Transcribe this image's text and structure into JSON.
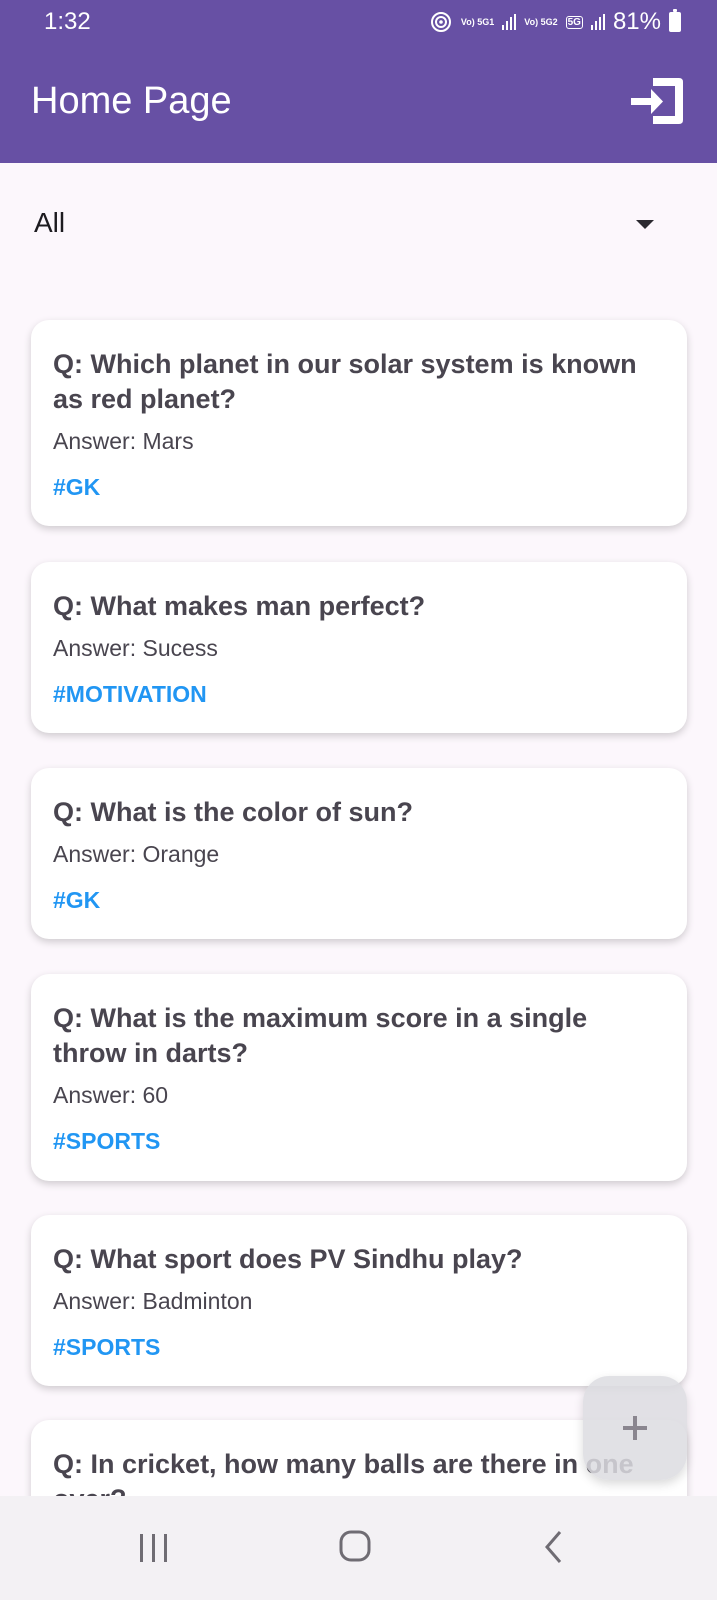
{
  "status_bar": {
    "time": "1:32",
    "battery": "81%",
    "net1": "Vo) 5G1",
    "net2": "Vo) 5G2",
    "badge": "5G"
  },
  "app_bar": {
    "title": "Home Page"
  },
  "filter": {
    "selected": "All"
  },
  "cards": [
    {
      "question": "Q: Which planet in our solar system is known as red planet?",
      "answer": "Answer: Mars",
      "tag": "#GK"
    },
    {
      "question": "Q: What makes man perfect?",
      "answer": "Answer: Sucess",
      "tag": "#MOTIVATION"
    },
    {
      "question": "Q: What is the color of sun?",
      "answer": "Answer: Orange",
      "tag": "#GK"
    },
    {
      "question": "Q: What is the maximum score in a single throw in darts?",
      "answer": "Answer: 60",
      "tag": "#SPORTS"
    },
    {
      "question": "Q: What sport does PV Sindhu play?",
      "answer": "Answer: Badminton",
      "tag": "#SPORTS"
    },
    {
      "question": "Q: In cricket, how many balls are there in one over?"
    }
  ],
  "colors": {
    "primary": "#6750a4",
    "tag": "#2196f3",
    "background": "#fcf7fc"
  }
}
